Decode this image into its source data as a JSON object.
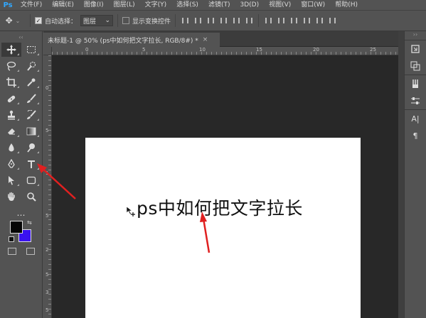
{
  "app": {
    "logo": "Ps"
  },
  "menu": [
    "文件(F)",
    "编辑(E)",
    "图像(I)",
    "图层(L)",
    "文字(Y)",
    "选择(S)",
    "滤镜(T)",
    "3D(D)",
    "视图(V)",
    "窗口(W)",
    "帮助(H)"
  ],
  "options": {
    "auto_select_label": "自动选择：",
    "auto_select_checked": true,
    "auto_select_target": "图层",
    "transform_controls_label": "显示变换控件",
    "transform_controls_checked": false
  },
  "document": {
    "tab_title": "未标题-1 @ 50% (ps中如何把文字拉长, RGB/8#) *",
    "close_glyph": "×",
    "canvas_text": "ps中如何把文字拉长",
    "ruler_h_ticks": [
      "0",
      "5",
      "10",
      "15",
      "20",
      "25"
    ],
    "ruler_v_ticks": [
      "0",
      "5",
      "1",
      "5",
      "2",
      "5",
      "3",
      "5"
    ]
  },
  "colors": {
    "foreground": "#050505",
    "background": "#3a12f0",
    "annotation_arrow": "#e02020",
    "accent": "#31a8ff"
  },
  "tools": [
    {
      "name": "move-tool-icon",
      "selected": true
    },
    {
      "name": "marquee-tool-icon"
    },
    {
      "name": "lasso-tool-icon"
    },
    {
      "name": "quick-select-tool-icon"
    },
    {
      "name": "crop-tool-icon"
    },
    {
      "name": "eyedropper-tool-icon"
    },
    {
      "name": "healing-brush-tool-icon"
    },
    {
      "name": "brush-tool-icon"
    },
    {
      "name": "clone-stamp-tool-icon"
    },
    {
      "name": "history-brush-tool-icon"
    },
    {
      "name": "eraser-tool-icon"
    },
    {
      "name": "gradient-tool-icon"
    },
    {
      "name": "blur-tool-icon"
    },
    {
      "name": "dodge-tool-icon"
    },
    {
      "name": "pen-tool-icon"
    },
    {
      "name": "type-tool-icon"
    },
    {
      "name": "path-select-tool-icon"
    },
    {
      "name": "shape-tool-icon"
    },
    {
      "name": "hand-tool-icon"
    },
    {
      "name": "zoom-tool-icon"
    }
  ],
  "more_tools": "…",
  "dock": {
    "character_label": "A|",
    "paragraph_label": "¶"
  }
}
